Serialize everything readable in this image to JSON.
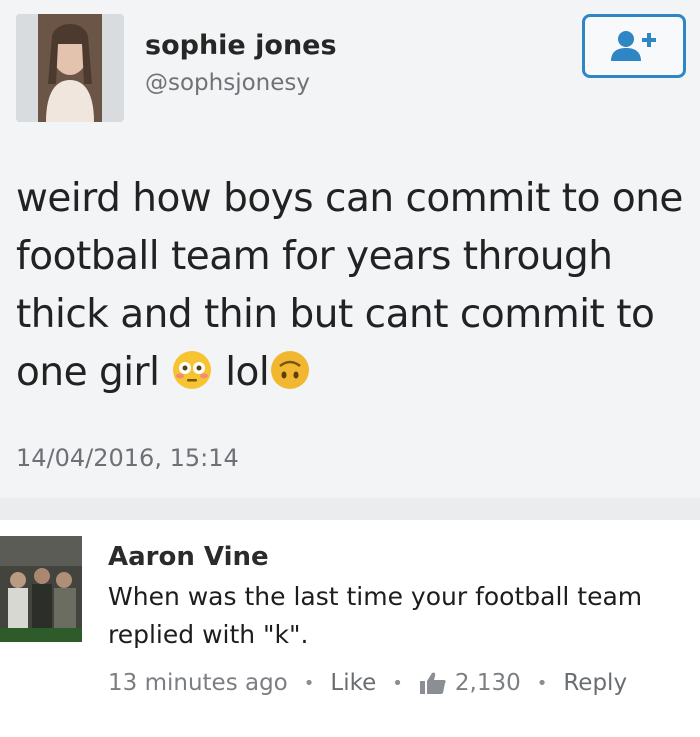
{
  "tweet": {
    "display_name": "sophie jones",
    "handle": "@sophsjonesy",
    "text_before": "weird how boys can commit to one football team for years through thick and thin but cant commit to one girl ",
    "text_middle": " lol",
    "timestamp": "14/04/2016, 15:14",
    "icons": [
      "avatar-photo",
      "follow-person-plus-icon",
      "flushed-face-emoji",
      "upside-down-face-emoji"
    ],
    "accent_color": "#2f86c5"
  },
  "comment": {
    "author": "Aaron Vine",
    "text": "When was the last time your football team replied with \"k\".",
    "time_ago": "13 minutes ago",
    "like_label": "Like",
    "like_count": "2,130",
    "reply_label": "Reply",
    "icons": [
      "avatar-photo",
      "thumbs-up-icon"
    ]
  }
}
